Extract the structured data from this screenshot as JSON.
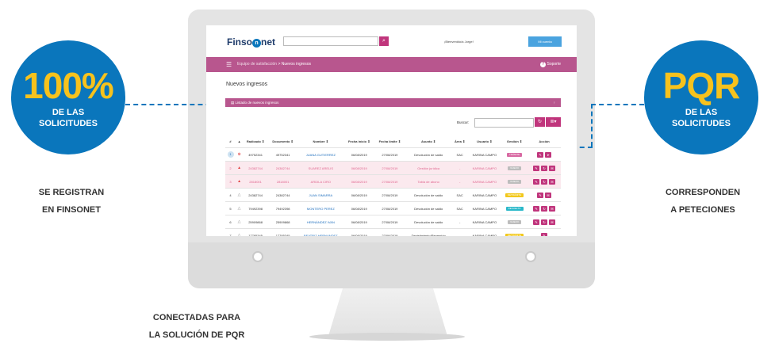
{
  "left_stat": {
    "big": "100%",
    "line1": "DE LAS",
    "line2": "SOLICITUDES",
    "caption_l1": "SE REGISTRAN",
    "caption_l2": "EN FINSONET"
  },
  "right_stat": {
    "big": "PQR",
    "line1": "DE LAS",
    "line2": "SOLICITUDES",
    "caption_l1": "CORRESPONDEN",
    "caption_l2": "A PETECIONES"
  },
  "bottom_caption": {
    "l1": "CONECTADAS PARA",
    "l2": "LA SOLUCIÓN DE PQR"
  },
  "app": {
    "logo_a": "Finso",
    "logo_o": "n",
    "logo_b": "net",
    "search_icon": "search-icon",
    "welcome": "¡Bienvenido/a Jorge!",
    "account_button": "Mi cuenta",
    "breadcrumb_root": "Equipo de satisfacción",
    "breadcrumb_sep": ">",
    "breadcrumb_current": "Nuevos ingresos",
    "support": "Soporte",
    "page_title": "Nuevos ingresos",
    "panel_title": "Listado de nuevos ingresos",
    "search_label": "Buscar:",
    "colors": {
      "accent": "#b8568e",
      "brand": "#0a76bc",
      "highlight": "#f7c21d"
    }
  },
  "table": {
    "headers": [
      "#",
      "▲",
      "Radicado ⇕",
      "Documento ⇕",
      "Nombre ⇕",
      "Fecha inicio ⇕",
      "Fecha límite ⇕",
      "Asunto ⇕",
      "Área ⇕",
      "Usuario ⇕",
      "Gestión ⇕",
      "Acción"
    ],
    "rows": [
      {
        "num": "1",
        "radicado": "49752341",
        "documento": "49752341",
        "nombre": "JUANA GUTIERREZ",
        "inicio": "06/08/2019",
        "limite": "27/08/2019",
        "asunto": "Devolución de saldo",
        "area": "SAC",
        "usuario": "KARINA CAMPO",
        "gestion": "TRÁMITE"
      },
      {
        "num": "2",
        "radicado": "24382744",
        "documento": "24382744",
        "nombre": "SUAREZ ARELIS",
        "inicio": "06/08/2019",
        "limite": "27/08/2019",
        "asunto": "Gestión jurídica",
        "area": "-",
        "usuario": "KARINA CAMPO",
        "gestion": "NUEVO"
      },
      {
        "num": "3",
        "radicado": "2818001",
        "documento": "2818001",
        "nombre": "ARDILA CIRO",
        "inicio": "06/08/2019",
        "limite": "27/08/2019",
        "asunto": "Tabla de abono",
        "area": "-",
        "usuario": "KARINA CAMPO",
        "gestion": "NUEVO"
      },
      {
        "num": "4",
        "radicado": "24382744",
        "documento": "24382744",
        "nombre": "JUAN SIMARRA",
        "inicio": "06/08/2019",
        "limite": "27/08/2019",
        "asunto": "Devolución de saldo",
        "area": "SAC",
        "usuario": "KARINA CAMPO",
        "gestion": "DETRÁMITE"
      },
      {
        "num": "5",
        "radicado": "79492398",
        "documento": "79492398",
        "nombre": "MONTERO PEREZ",
        "inicio": "06/08/2019",
        "limite": "27/08/2019",
        "asunto": "Devolución de saldo",
        "area": "SAC",
        "usuario": "KARINA CAMPO",
        "gestion": "RESUELTO"
      },
      {
        "num": "6",
        "radicado": "25909868",
        "documento": "25909868",
        "nombre": "HERNÁNDEZ IVAN",
        "inicio": "06/08/2019",
        "limite": "27/08/2019",
        "asunto": "Devolución de saldo",
        "area": "-",
        "usuario": "KARINA CAMPO",
        "gestion": "NUEVO"
      },
      {
        "num": "7",
        "radicado": "17785345",
        "documento": "17785345",
        "nombre": "BEATRIZ HERNANDEZ",
        "inicio": "06/08/2019",
        "limite": "27/08/2019",
        "asunto": "Desistimiento/Reversión",
        "area": "-",
        "usuario": "KARINA CAMPO",
        "gestion": "DETRÁMITE"
      }
    ]
  }
}
